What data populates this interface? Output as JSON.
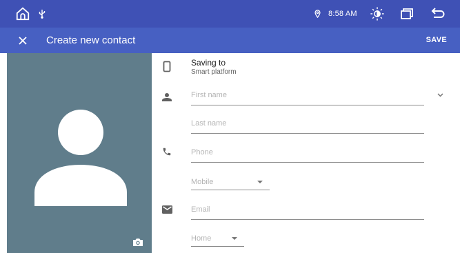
{
  "status_bar": {
    "time": "8:58 AM",
    "icons": [
      "home-icon",
      "usb-icon",
      "location-icon",
      "brightness-icon",
      "recents-icon",
      "back-icon"
    ]
  },
  "app_bar": {
    "title": "Create new contact",
    "save_label": "SAVE",
    "close_icon": "close-icon"
  },
  "colors": {
    "status_bar": "#3f51b5",
    "app_bar": "#4760c2",
    "photo_bg": "#607d8b"
  },
  "saving_to": {
    "title": "Saving to",
    "account": "Smart platform"
  },
  "fields": {
    "first_name": {
      "placeholder": "First name",
      "value": ""
    },
    "last_name": {
      "placeholder": "Last name",
      "value": ""
    },
    "phone": {
      "placeholder": "Phone",
      "value": ""
    },
    "phone_type": {
      "selected": "Mobile"
    },
    "email": {
      "placeholder": "Email",
      "value": ""
    },
    "email_type": {
      "selected": "Home"
    }
  }
}
